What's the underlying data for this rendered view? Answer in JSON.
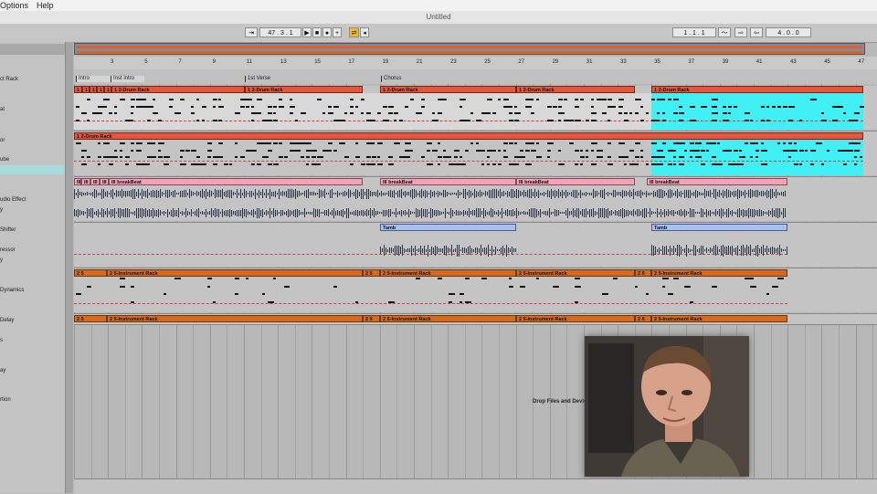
{
  "menu": {
    "options": "Options",
    "help": "Help"
  },
  "window": {
    "title": "Untitled"
  },
  "transport": {
    "follow": "⇥",
    "position": "47 . 3 . 1",
    "play": "▶",
    "stop": "■",
    "record": "●",
    "add": "+",
    "loop_toggle": "⇄",
    "punch": "◂",
    "loop_start": "1 . 1 . 1",
    "draw_mode": "〜",
    "punch_in": "⇨",
    "punch_out": "⇦",
    "loop_length": "4 . 0 . 0",
    "accent_color": "#f0b92d"
  },
  "browser": {
    "items": [
      {
        "label": "ct Rack"
      },
      {
        "label": "at"
      },
      {
        "label": "or"
      },
      {
        "label": "ube"
      },
      {
        "label": ""
      },
      {
        "label": "udio Effect"
      },
      {
        "label": "y"
      },
      {
        "label": "Shifter"
      },
      {
        "label": "ressor"
      },
      {
        "label": "y"
      },
      {
        "label": "Dynamics"
      },
      {
        "label": "Delay"
      },
      {
        "label": "s"
      },
      {
        "label": "ay"
      },
      {
        "label": "rtion"
      }
    ]
  },
  "ruler": {
    "ticks": [
      "3",
      "5",
      "7",
      "9",
      "11",
      "13",
      "15",
      "17",
      "19",
      "21",
      "23",
      "25",
      "27",
      "29",
      "31",
      "33",
      "35",
      "37",
      "39",
      "41",
      "43",
      "45",
      "47"
    ]
  },
  "locators": [
    {
      "label": "Intro"
    },
    {
      "label": "Inst intro"
    },
    {
      "label": "1st Verse"
    },
    {
      "label": "Chorus"
    }
  ],
  "tracks": {
    "drum1_clips": [
      "1 2",
      "1 2",
      "1 2",
      "1 2",
      "1 2",
      "1 2-Drum Rack",
      "1 2-Drum Rack",
      "1 2-Drum Rack",
      "1 2-Drum Rack",
      "1 2-Drum Rack",
      "1 2-Drum Rack"
    ],
    "break_clips": [
      "III",
      "III",
      "III",
      "III",
      "III breakBeat",
      "III breakBeat",
      "III breakBeat",
      "III breakBeat"
    ],
    "tamb_clips": [
      "Tamb",
      "Tamb"
    ],
    "inst_clips": [
      "2 5",
      "2 5",
      "2 5",
      "2 5-Instrument Rack",
      "2 5-Instrument Rack",
      "2 5-Instrument Rack",
      "2 5-Instrument Rack"
    ]
  },
  "drop_message": "Drop Files and Devices",
  "colors": {
    "drum_clip": "#e8553d",
    "break_clip": "#f2a3b8",
    "tamb_clip": "#a8c0f4",
    "inst_clip": "#d76a1c",
    "selection": "#40f0f4"
  }
}
